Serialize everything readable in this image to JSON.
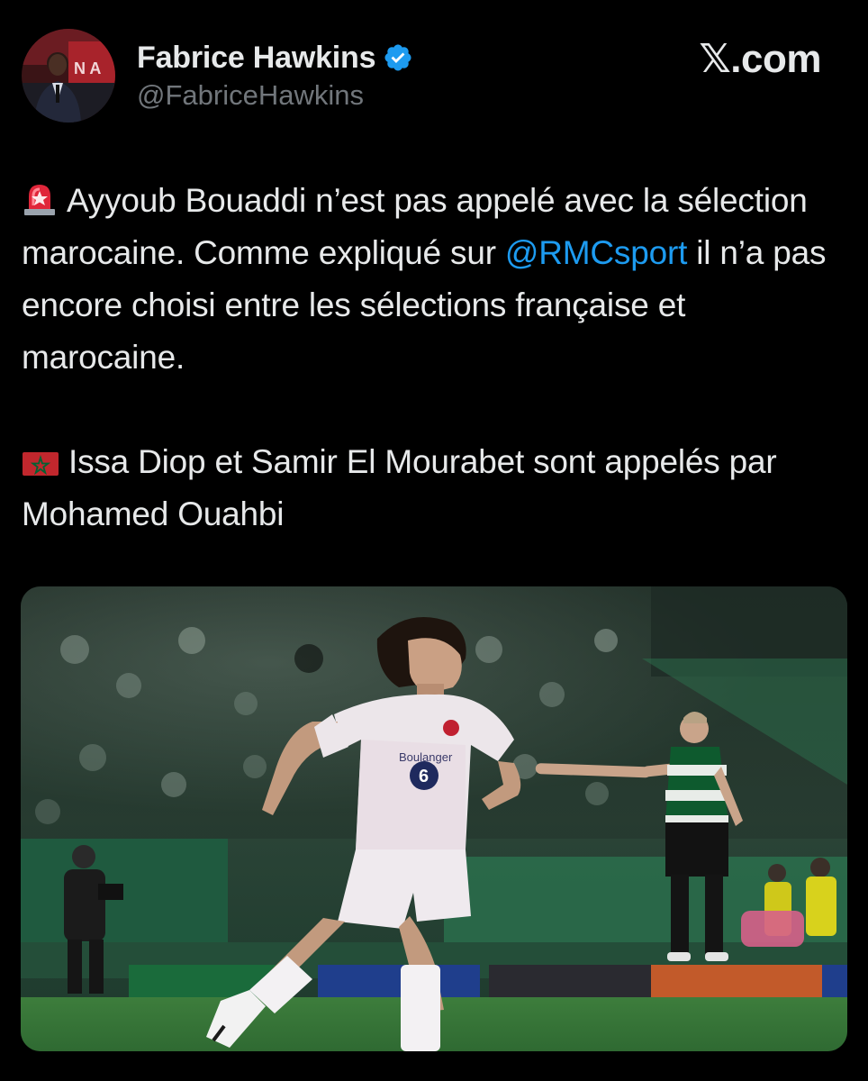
{
  "author": {
    "display_name": "Fabrice Hawkins",
    "handle": "@FabriceHawkins",
    "verified": true,
    "avatar_icon": "profile-photo",
    "avatar_text": "N A"
  },
  "brand": {
    "label": "𝕏.com",
    "icon": "x-logo-icon"
  },
  "tweet": {
    "line1_emoji": "siren-emoji",
    "line1_before": "Ayyoub Bouaddi n’est pas appelé avec la sélection marocaine. Comme expliqué sur ",
    "mention": "@RMCsport",
    "line1_after": " il n’a pas encore choisi entre les sélections française et marocaine.",
    "line2_emoji": "morocco-flag-emoji",
    "line2": "Issa Diop et Samir El Mourabet sont appelés par Mohamed Ouahbi"
  },
  "media": {
    "type": "photo",
    "shirt_number": "6",
    "shirt_sponsor": "Boulanger"
  },
  "colors": {
    "background": "#000000",
    "text": "#e7e9ea",
    "secondary": "#71767b",
    "link": "#1d9bf0",
    "verified": "#1d9bf0"
  }
}
